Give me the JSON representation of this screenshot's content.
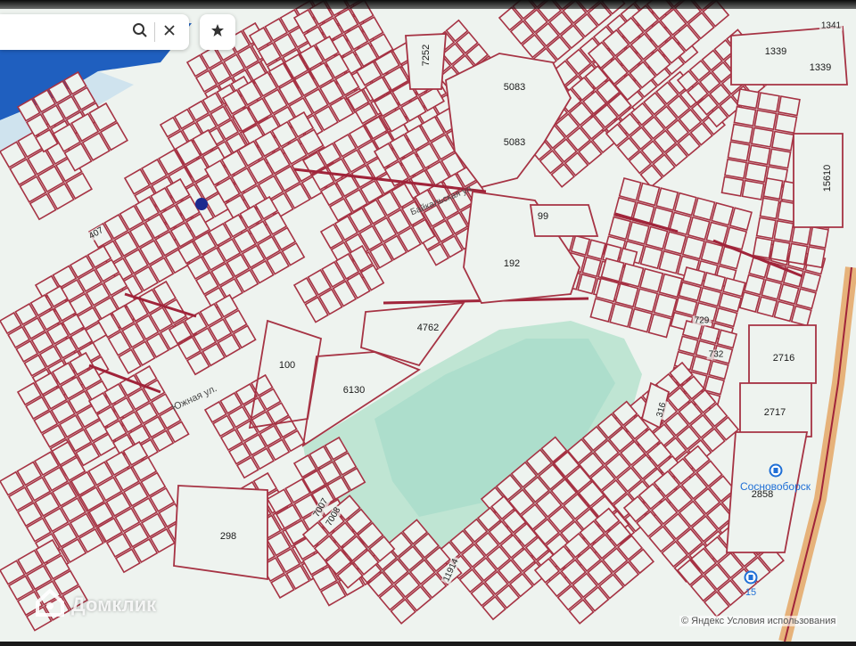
{
  "search": {
    "placeholder": ""
  },
  "icons": {
    "search": "search-icon",
    "clear": "close-icon",
    "favorite": "star-icon"
  },
  "colors": {
    "parcel_line": "#a63344",
    "road_line": "#a0243a",
    "water": "#1f5fbf",
    "forest": "#bfe5d3",
    "background": "#eef3ef",
    "poi": "#1f6fd6"
  },
  "parcel_labels": [
    {
      "id": "7252",
      "text": "7252"
    },
    {
      "id": "5083a",
      "text": "5083"
    },
    {
      "id": "5083b",
      "text": "5083"
    },
    {
      "id": "1339a",
      "text": "1339"
    },
    {
      "id": "1339b",
      "text": "1339"
    },
    {
      "id": "15610",
      "text": "15610"
    },
    {
      "id": "99",
      "text": "99"
    },
    {
      "id": "192",
      "text": "192"
    },
    {
      "id": "4762",
      "text": "4762"
    },
    {
      "id": "100",
      "text": "100"
    },
    {
      "id": "6130",
      "text": "6130"
    },
    {
      "id": "2716",
      "text": "2716"
    },
    {
      "id": "2717",
      "text": "2717"
    },
    {
      "id": "2858",
      "text": "2858"
    },
    {
      "id": "298",
      "text": "298"
    },
    {
      "id": "7007",
      "text": "7007"
    },
    {
      "id": "7008",
      "text": "7008"
    },
    {
      "id": "11914",
      "text": "11914"
    },
    {
      "id": "316",
      "text": "316"
    },
    {
      "id": "729",
      "text": "729"
    },
    {
      "id": "732",
      "text": "732"
    },
    {
      "id": "407",
      "text": "407"
    },
    {
      "id": "1341",
      "text": "1341"
    }
  ],
  "street_labels": [
    {
      "id": "yuzhnaya",
      "text": "Южная ул."
    },
    {
      "id": "baikalskaya",
      "text": "Байкальская ул."
    }
  ],
  "pois": [
    {
      "id": "sanatorium",
      "text": "Сосновоборск",
      "icon": "poi-icon"
    },
    {
      "id": "bus-stop",
      "text": "15",
      "icon": "bus-stop-icon"
    }
  ],
  "watermark": {
    "text": "Домклик",
    "icon": "domclick-logo-icon"
  },
  "copyright": "© Яндекс Условия использования"
}
